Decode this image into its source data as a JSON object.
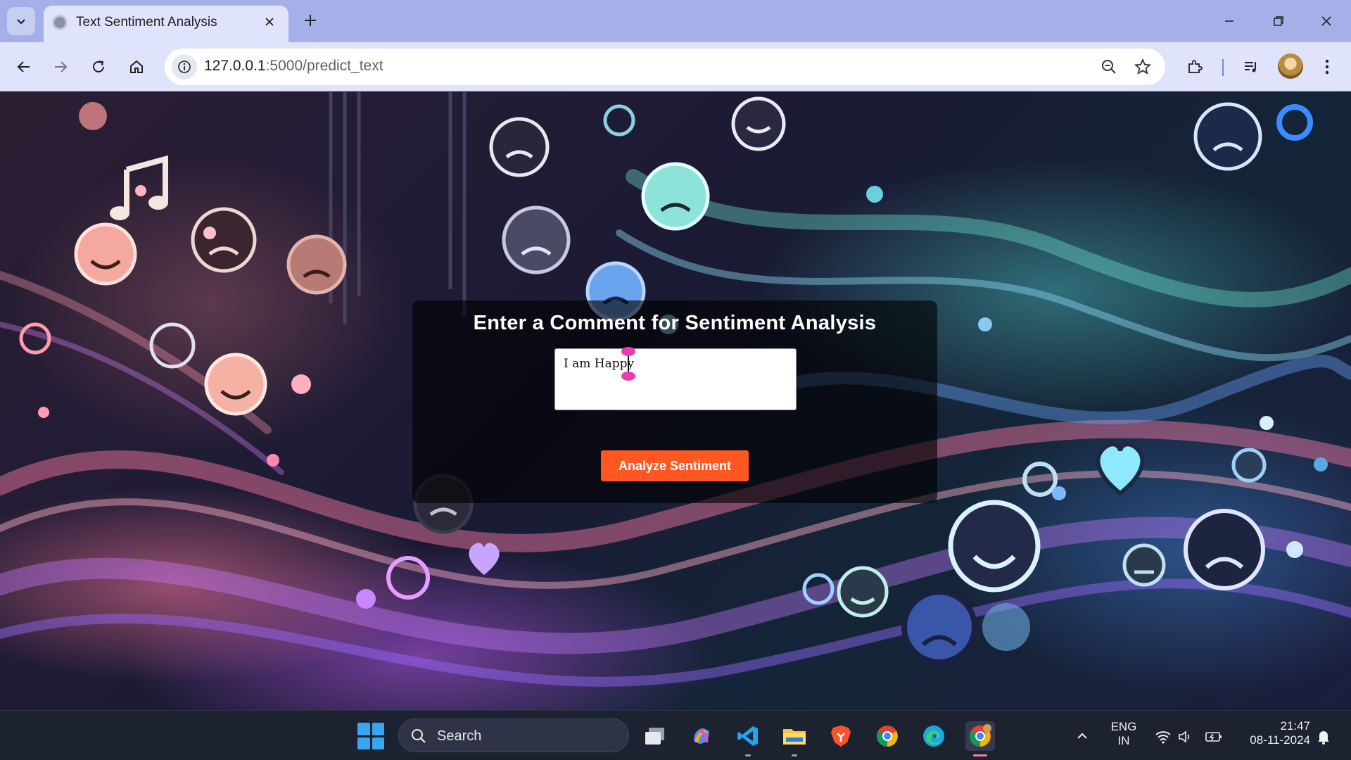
{
  "browser": {
    "tab_title": "Text Sentiment Analysis",
    "url_host": "127.0.0.1",
    "url_rest": ":5000/predict_text"
  },
  "page": {
    "heading": "Enter a Comment for Sentiment Analysis",
    "comment_value": "I am Happy",
    "analyze_button": "Analyze Sentiment"
  },
  "taskbar": {
    "search_label": "Search",
    "apps": [
      "task-view",
      "copilot",
      "vscode",
      "file-explorer",
      "brave",
      "chrome",
      "edge",
      "chrome-profile"
    ],
    "lang_line1": "ENG",
    "lang_line2": "IN",
    "time": "21:47",
    "date": "08-11-2024"
  },
  "colors": {
    "tabstrip": "#a5b0e9",
    "toolbar": "#dfe3fb",
    "button_accent": "#ff5722",
    "taskbar": "#1d2230"
  }
}
